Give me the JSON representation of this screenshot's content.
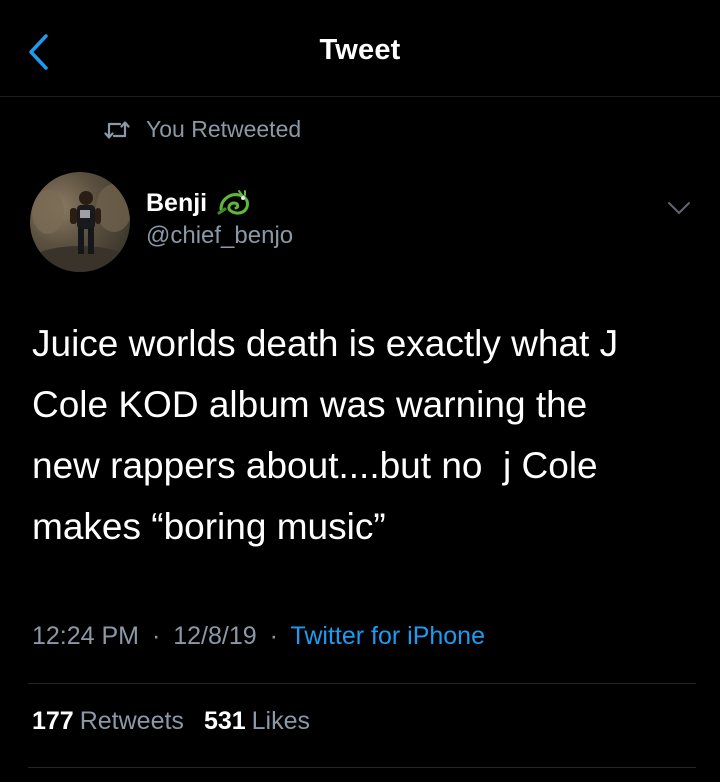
{
  "header": {
    "title": "Tweet"
  },
  "retweet_indicator": {
    "text": "You Retweeted"
  },
  "tweet": {
    "author_name": "Benji",
    "author_handle": "@chief_benjo",
    "text": "Juice worlds death is exactly what J\nCole KOD album was warning the\nnew rappers about....but no  j Cole\nmakes “boring music”",
    "time": "12:24 PM",
    "date": "12/8/19",
    "separator": "·",
    "source": "Twitter for iPhone",
    "retweets_count": "177",
    "retweets_label": "Retweets",
    "likes_count": "531",
    "likes_label": "Likes"
  },
  "colors": {
    "background": "#000000",
    "accent": "#1d9bf0",
    "secondary_text": "#8b98a5"
  },
  "icons": {
    "back": "chevron-left-icon",
    "retweet": "retweet-icon",
    "more": "chevron-down-icon",
    "emoji": "dragon-emoji-icon"
  }
}
